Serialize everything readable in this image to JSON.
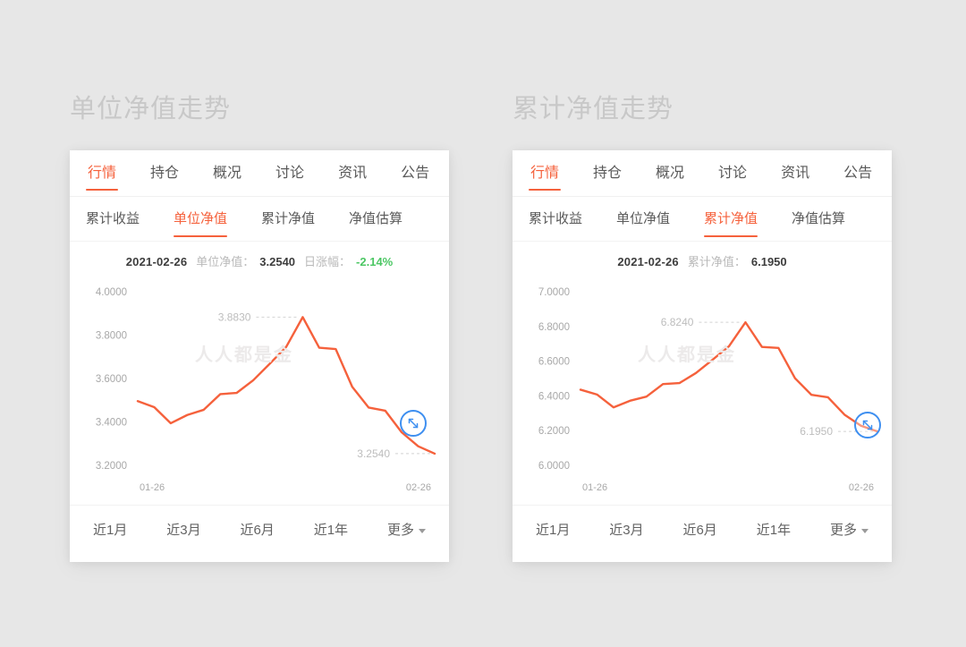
{
  "page": {
    "background": "#e7e7e7",
    "accent": "#f5613c",
    "positive_color": "#4cc764",
    "cursor_color": "#3e8ff0"
  },
  "panels": [
    {
      "title": "单位净值走势",
      "main_tabs": [
        {
          "label": "行情",
          "active": true
        },
        {
          "label": "持仓",
          "active": false
        },
        {
          "label": "概况",
          "active": false
        },
        {
          "label": "讨论",
          "active": false
        },
        {
          "label": "资讯",
          "active": false
        },
        {
          "label": "公告",
          "active": false
        }
      ],
      "sub_tabs": [
        {
          "label": "累计收益",
          "active": false
        },
        {
          "label": "单位净值",
          "active": true
        },
        {
          "label": "累计净值",
          "active": false
        },
        {
          "label": "净值估算",
          "active": false
        }
      ],
      "info": {
        "date": "2021-02-26",
        "value_label": "单位净值：",
        "value": "3.2540",
        "change_label": "日涨幅：",
        "change": "-2.14%",
        "has_change": true
      },
      "periods": [
        {
          "label": "近1月"
        },
        {
          "label": "近3月"
        },
        {
          "label": "近6月"
        },
        {
          "label": "近1年"
        },
        {
          "label": "更多",
          "caret": true
        }
      ],
      "watermark": "人人都是金",
      "cursor_icon": "resize-diagonal-icon",
      "chart_data": {
        "type": "line",
        "title": "单位净值走势",
        "xlabel": "",
        "ylabel": "",
        "ylim": [
          3.2,
          4.0
        ],
        "yticks": [
          4.0,
          3.8,
          3.6,
          3.4,
          3.2
        ],
        "ytick_labels": [
          "4.0000",
          "3.8000",
          "3.6000",
          "3.4000",
          "3.2000"
        ],
        "xticks": [
          "01-26",
          "02-26"
        ],
        "grid": false,
        "legend": "none",
        "annotations": [
          {
            "text": "3.8830",
            "value": 3.883,
            "kind": "peak"
          },
          {
            "text": "3.2540",
            "value": 3.254,
            "kind": "last"
          }
        ],
        "series": [
          {
            "name": "单位净值",
            "color": "#f5613c",
            "x": [
              "01-26",
              "01-27",
              "01-28",
              "01-29",
              "02-01",
              "02-02",
              "02-03",
              "02-04",
              "02-05",
              "02-08",
              "02-09",
              "02-10",
              "02-18",
              "02-19",
              "02-22",
              "02-23",
              "02-24",
              "02-25",
              "02-26"
            ],
            "values": [
              3.496,
              3.468,
              3.394,
              3.432,
              3.456,
              3.528,
              3.534,
              3.592,
              3.668,
              3.746,
              3.883,
              3.742,
              3.736,
              3.562,
              3.466,
              3.452,
              3.352,
              3.288,
              3.254
            ]
          }
        ]
      }
    },
    {
      "title": "累计净值走势",
      "main_tabs": [
        {
          "label": "行情",
          "active": true
        },
        {
          "label": "持仓",
          "active": false
        },
        {
          "label": "概况",
          "active": false
        },
        {
          "label": "讨论",
          "active": false
        },
        {
          "label": "资讯",
          "active": false
        },
        {
          "label": "公告",
          "active": false
        }
      ],
      "sub_tabs": [
        {
          "label": "累计收益",
          "active": false
        },
        {
          "label": "单位净值",
          "active": false
        },
        {
          "label": "累计净值",
          "active": true
        },
        {
          "label": "净值估算",
          "active": false
        }
      ],
      "info": {
        "date": "2021-02-26",
        "value_label": "累计净值：",
        "value": "6.1950",
        "change_label": "",
        "change": "",
        "has_change": false
      },
      "periods": [
        {
          "label": "近1月"
        },
        {
          "label": "近3月"
        },
        {
          "label": "近6月"
        },
        {
          "label": "近1年"
        },
        {
          "label": "更多",
          "caret": true
        }
      ],
      "watermark": "人人都是金",
      "cursor_icon": "resize-diagonal-icon",
      "chart_data": {
        "type": "line",
        "title": "累计净值走势",
        "xlabel": "",
        "ylabel": "",
        "ylim": [
          6.0,
          7.0
        ],
        "yticks": [
          7.0,
          6.8,
          6.6,
          6.4,
          6.2,
          6.0
        ],
        "ytick_labels": [
          "7.0000",
          "6.8000",
          "6.6000",
          "6.4000",
          "6.2000",
          "6.0000"
        ],
        "xticks": [
          "01-26",
          "02-26"
        ],
        "grid": false,
        "legend": "none",
        "annotations": [
          {
            "text": "6.8240",
            "value": 6.824,
            "kind": "peak"
          },
          {
            "text": "6.1950",
            "value": 6.195,
            "kind": "last"
          }
        ],
        "series": [
          {
            "name": "累计净值",
            "color": "#f5613c",
            "x": [
              "01-26",
              "01-27",
              "01-28",
              "01-29",
              "02-01",
              "02-02",
              "02-03",
              "02-04",
              "02-05",
              "02-08",
              "02-09",
              "02-10",
              "02-18",
              "02-19",
              "02-22",
              "02-23",
              "02-24",
              "02-25",
              "02-26"
            ],
            "values": [
              6.436,
              6.408,
              6.334,
              6.372,
              6.396,
              6.468,
              6.474,
              6.532,
              6.608,
              6.686,
              6.824,
              6.682,
              6.676,
              6.502,
              6.406,
              6.392,
              6.292,
              6.228,
              6.195
            ]
          }
        ]
      }
    }
  ]
}
